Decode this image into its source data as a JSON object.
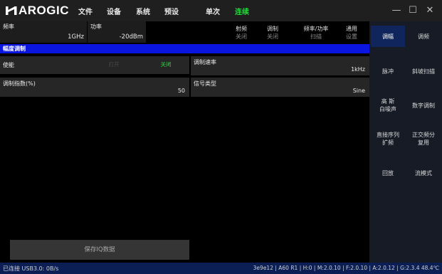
{
  "app": {
    "logo_text": "AROGIC",
    "menu": [
      "文件",
      "设备",
      "系统",
      "预设",
      "单次",
      "连续"
    ],
    "active_menu": "连续"
  },
  "params": {
    "freq_label": "频率",
    "freq_value": "1GHz",
    "power_label": "功率",
    "power_value": "-20dBm"
  },
  "toggles": [
    {
      "line1": "射频",
      "line2": "关闭"
    },
    {
      "line1": "调制",
      "line2": "关闭"
    },
    {
      "line1": "频率/功率",
      "line2": "扫描"
    },
    {
      "line1": "通用",
      "line2": "设置"
    }
  ],
  "section": {
    "title": "幅度调制"
  },
  "am": {
    "enable_label": "使能",
    "enable_on": "打开",
    "enable_off": "关闭",
    "rate_label": "调制速率",
    "rate_value": "1kHz",
    "depth_label": "调制指数(%)",
    "depth_value": "50",
    "signal_label": "信号类型",
    "signal_value": "Sine",
    "save_label": "保存IQ数据"
  },
  "sidebar": [
    {
      "label": "调幅",
      "selected": true
    },
    {
      "label": "调频",
      "selected": false
    },
    {
      "label": "脉冲",
      "selected": false
    },
    {
      "label": "斜坡扫描",
      "selected": false
    },
    {
      "label": "高 斯\n白噪声",
      "selected": false
    },
    {
      "label": "数字调制",
      "selected": false
    },
    {
      "label": "直接序列\n扩频",
      "selected": false
    },
    {
      "label": "正交频分\n复用",
      "selected": false
    },
    {
      "label": "回放",
      "selected": false
    },
    {
      "label": "流模式",
      "selected": false
    }
  ],
  "status": {
    "connection": "已连接 USB3.0: 0B/s",
    "info": "3e9e12 | A60 R1 | H:0 | M:2.0.10 | F:2.0.10 | A:2.0.12 | G:2.3.4  48.4℃"
  },
  "window_controls": {
    "minimize": "—",
    "maximize": "☐",
    "close": "✕"
  },
  "colors": {
    "accent_green": "#22d43c",
    "section_blue": "#0a16e0",
    "statusbar_blue": "#0b1f54",
    "sidebar_selected": "#0f255c"
  }
}
